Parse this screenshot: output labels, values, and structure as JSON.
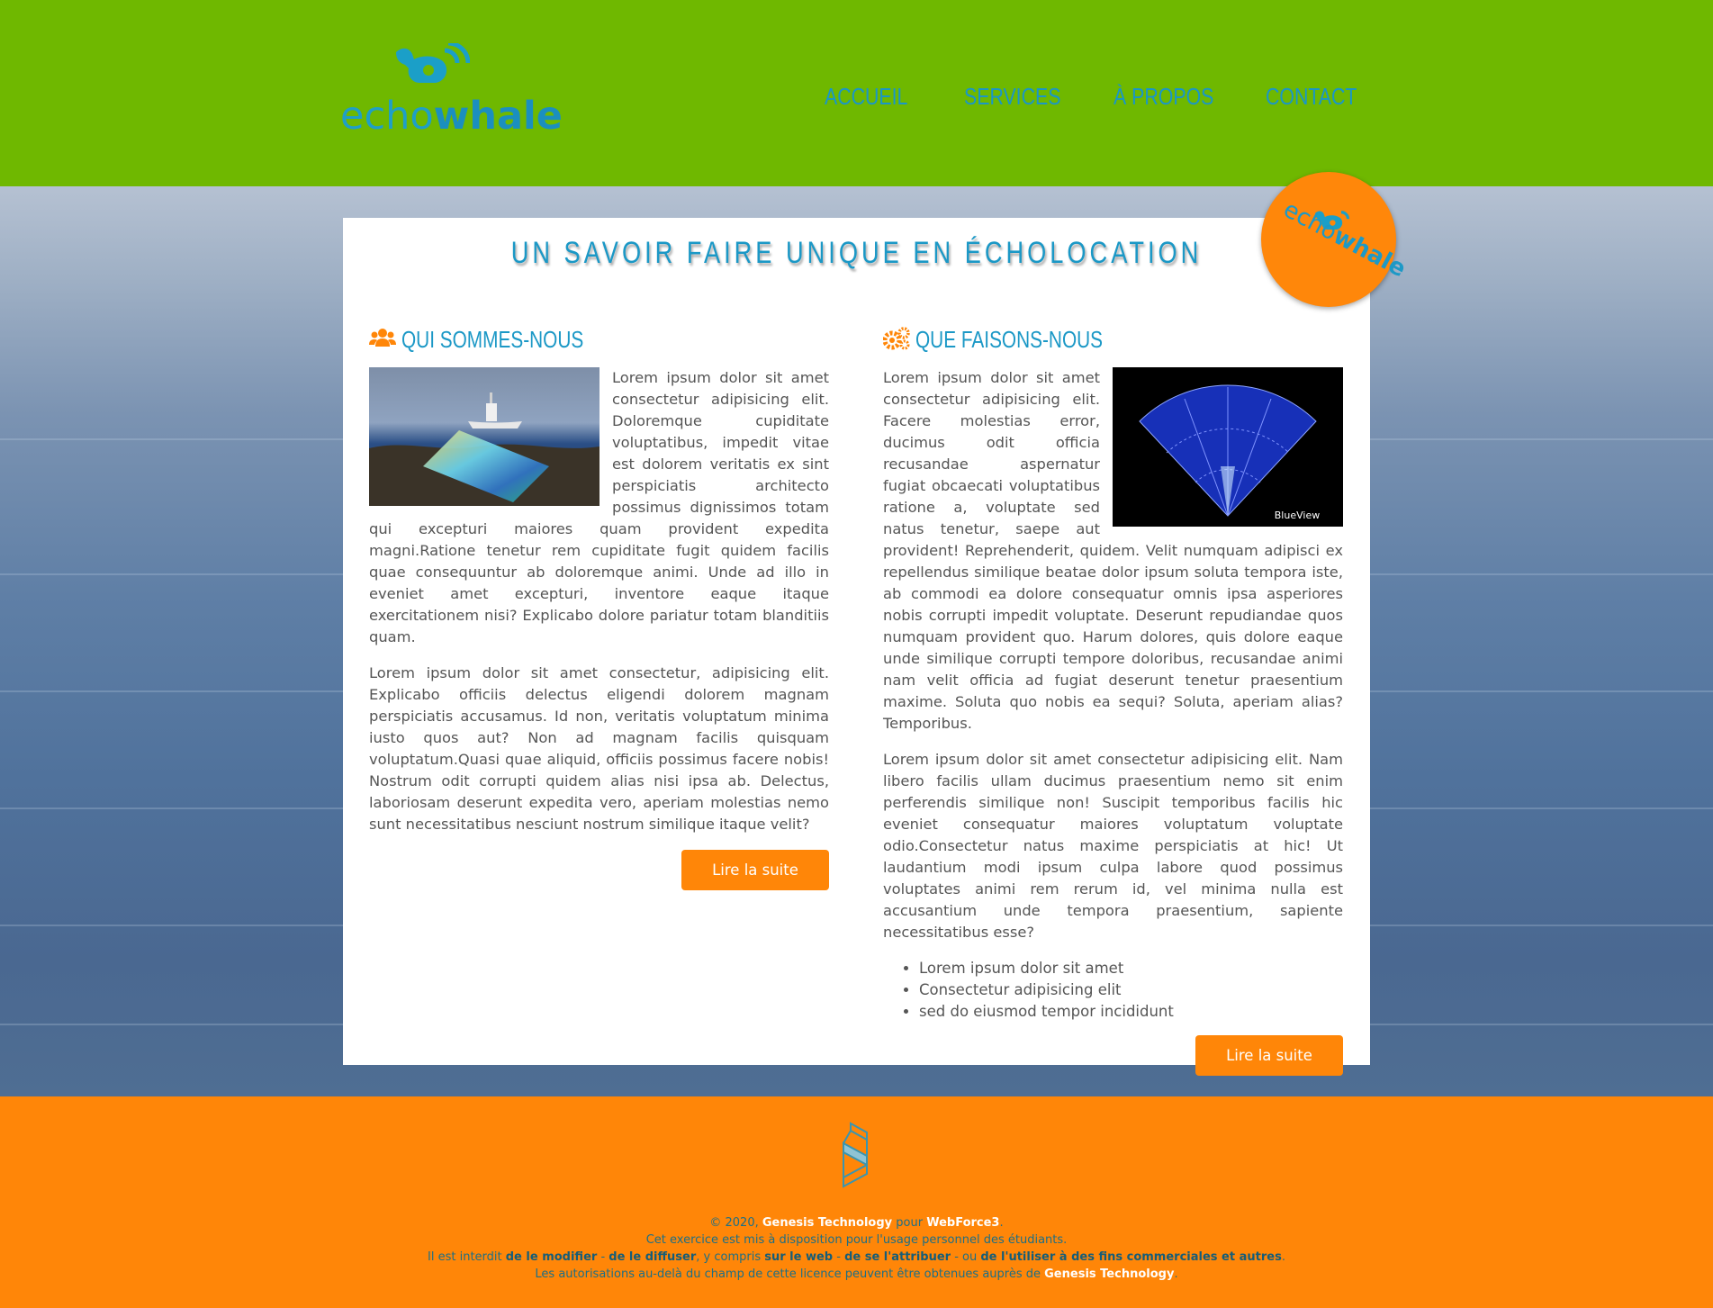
{
  "header": {
    "logo": {
      "text_light": "echo",
      "text_bold": "whale",
      "icon": "whale-icon"
    },
    "nav": [
      {
        "label": "ACCUEIL"
      },
      {
        "label": "SERVICES"
      },
      {
        "label": "À PROPOS"
      },
      {
        "label": "CONTACT"
      }
    ]
  },
  "badge": {
    "text_light": "echo",
    "text_bold": "whale",
    "icon": "whale-icon"
  },
  "main": {
    "title": "UN SAVOIR FAIRE UNIQUE EN ÉCHOLOCATION",
    "left": {
      "heading": "QUI SOMMES-NOUS",
      "icon": "users-icon",
      "image": "ship-sonar-image",
      "paragraphs": [
        "Lorem ipsum dolor sit amet consectetur adipisicing elit. Doloremque cupiditate voluptatibus, impedit vitae est dolorem veritatis ex sint perspiciatis architecto possimus dignissimos totam qui excepturi maiores quam provident expedita magni.Ratione tenetur rem cupiditate fugit quidem facilis quae consequuntur ab doloremque animi. Unde ad illo in eveniet amet excepturi, inventore eaque itaque exercitationem nisi? Explicabo dolore pariatur totam blanditiis quam.",
        "Lorem ipsum dolor sit amet consectetur, adipisicing elit. Explicabo officiis delectus eligendi dolorem magnam perspiciatis accusamus. Id non, veritatis voluptatum minima iusto quos aut? Non ad magnam facilis quisquam voluptatum.Quasi quae aliquid, officiis possimus facere nobis! Nostrum odit corrupti quidem alias nisi ipsa ab. Delectus, laboriosam deserunt expedita vero, aperiam molestias nemo sunt necessitatibus nesciunt nostrum similique itaque velit?"
      ],
      "button": "Lire la suite"
    },
    "right": {
      "heading": "QUE FAISONS-NOUS",
      "icon": "gears-icon",
      "image": "sonar-scan-image",
      "image_caption": "BlueView",
      "paragraphs": [
        "Lorem ipsum dolor sit amet consectetur adipisicing elit. Facere molestias error, ducimus odit officia recusandae aspernatur fugiat obcaecati voluptatibus ratione a, voluptate sed natus tenetur, saepe aut provident! Reprehenderit, quidem. Velit numquam adipisci ex repellendus similique beatae dolor ipsum soluta tempora iste, ab commodi ea dolore consequatur omnis ipsa asperiores nobis corrupti impedit voluptate. Deserunt repudiandae quos numquam provident quo. Harum dolores, quis dolore eaque unde similique corrupti tempore doloribus, recusandae animi nam velit officia ad fugiat deserunt tenetur praesentium maxime. Soluta quo nobis ea sequi? Soluta, aperiam alias? Temporibus.",
        "Lorem ipsum dolor sit amet consectetur adipisicing elit. Nam libero facilis ullam ducimus praesentium nemo sit enim perferendis similique non! Suscipit temporibus facilis hic eveniet consequatur maiores voluptatum voluptate odio.Consectetur natus maxime perspiciatis at hic! Ut laudantium modi ipsum culpa labore quod possimus voluptates animi rem rerum id, vel minima nulla est accusantium unde tempora praesentium, sapiente necessitatibus esse?"
      ],
      "list": [
        "Lorem ipsum dolor sit amet",
        "Consectetur adipisicing elit",
        "sed do eiusmod tempor incididunt"
      ],
      "button": "Lire la suite"
    }
  },
  "footer": {
    "icon": "genesis-logo-icon",
    "line1": {
      "a": "© 2020, ",
      "b": "Genesis Technology",
      "c": " pour ",
      "d": "WebForce3",
      "e": "."
    },
    "line2": "Cet exercice est mis à disposition pour l'usage personnel des étudiants.",
    "line3": {
      "a": "Il est interdit ",
      "b": "de le modifier",
      "c": " - ",
      "d": "de le diffuser",
      "e": ", y compris ",
      "f": "sur le web",
      "g": " - ",
      "h": "de se l'attribuer",
      "i": " - ou ",
      "j": "de l'utiliser à des fins commerciales et autres",
      "k": "."
    },
    "line4": {
      "a": "Les autorisations au-delà du champ de cette licence peuvent être obtenues auprès de ",
      "b": "Genesis Technology",
      "c": "."
    }
  },
  "colors": {
    "header_green": "#6fb800",
    "brand_blue": "#1b98c6",
    "accent_orange": "#ff8608",
    "text_gray": "#555555"
  }
}
